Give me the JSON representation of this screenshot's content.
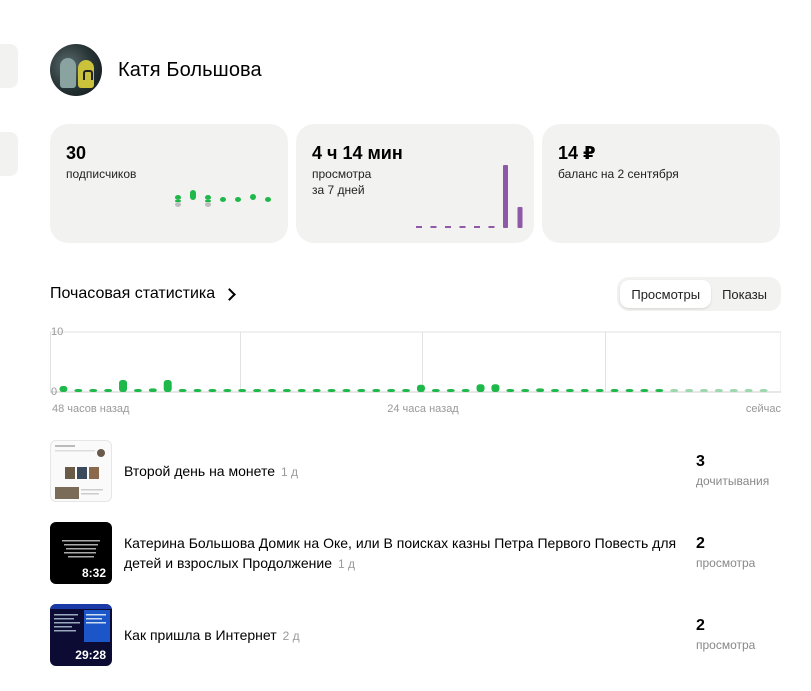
{
  "profile": {
    "name": "Катя Большова"
  },
  "cards": [
    {
      "value": "30",
      "label": "подписчиков",
      "label2": ""
    },
    {
      "value": "4 ч 14 мин",
      "label": "просмотра",
      "label2": "за 7 дней"
    },
    {
      "value": "14 ₽",
      "label": "баланс на 2 сентября",
      "label2": ""
    }
  ],
  "section": {
    "title": "Почасовая статистика"
  },
  "tabs": [
    {
      "label": "Просмотры",
      "active": true
    },
    {
      "label": "Показы",
      "active": false
    }
  ],
  "colors": {
    "green": "#1fb84a",
    "green_light": "#9bd9ad",
    "purple": "#8e5aa8",
    "grid": "#e2e2e2",
    "card_bg": "#f2f2f0"
  },
  "chart_data": {
    "type": "bar",
    "title": "",
    "ylim": [
      0,
      10
    ],
    "y_ticks": [
      "10",
      "0"
    ],
    "x_ticks": [
      "48 часов назад",
      "24 часа назад",
      "сейчас"
    ],
    "values": [
      1,
      0.3,
      0.3,
      0.3,
      2,
      0.5,
      0.6,
      2,
      0.3,
      0.5,
      0.3,
      0.3,
      0.3,
      0.3,
      0.3,
      0.3,
      0.3,
      0.3,
      0.3,
      0.3,
      0.3,
      0.5,
      0.3,
      0.5,
      1.2,
      0.5,
      0.3,
      0.3,
      1.3,
      1.3,
      0.5,
      0.3,
      0.6,
      0.3,
      0.3,
      0.3,
      0.3,
      0.3,
      0.3,
      0.3,
      0.3,
      0.3,
      0.3,
      0.3,
      0.3,
      0.3,
      0.3,
      0.3
    ],
    "faded_last": 7
  },
  "sparks": {
    "subscribers": [
      -1,
      2,
      -1,
      0,
      0,
      1,
      0
    ],
    "views": [
      0,
      0,
      0,
      0,
      0,
      0,
      6,
      2
    ]
  },
  "items": [
    {
      "title": "Второй день на монете",
      "age": "1 д",
      "count": "3",
      "count_label": "дочитывания",
      "duration": ""
    },
    {
      "title": "Катерина Большова Домик на Оке, или В поисках казны Петра Первого Повесть для детей и взрослых Продолжение",
      "age": "1 д",
      "count": "2",
      "count_label": "просмотра",
      "duration": "8:32"
    },
    {
      "title": "Как пришла в Интернет",
      "age": "2 д",
      "count": "2",
      "count_label": "просмотра",
      "duration": "29:28"
    }
  ]
}
